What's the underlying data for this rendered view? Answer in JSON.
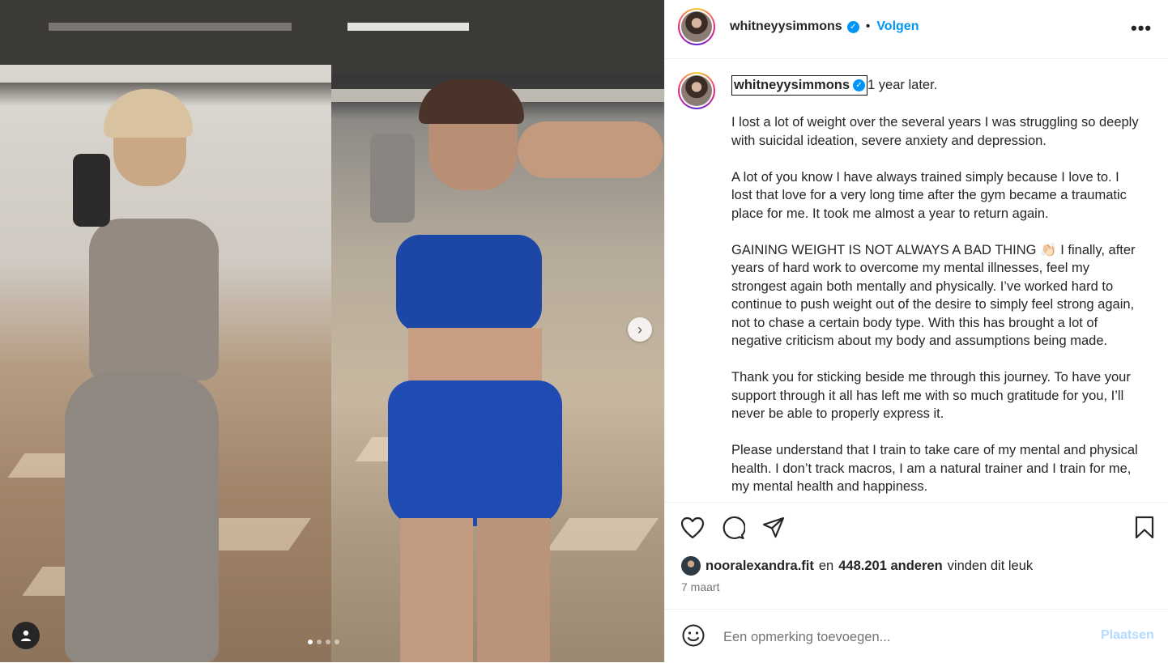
{
  "media": {
    "carousel_dot_count": 4,
    "active_dot_index": 0
  },
  "header": {
    "username": "whitneyysimmons",
    "separator": "•",
    "follow_label": "Volgen",
    "more_icon": "more-horizontal-icon",
    "verified_icon": "verified-badge-icon"
  },
  "caption": {
    "username": "whitneyysimmons",
    "first_line": "1 year later.",
    "paragraphs": [
      "I lost a lot of weight over the several years I was struggling so deeply with suicidal ideation, severe anxiety and depression.",
      "A lot of you know I have always trained simply because I love to. I lost that love for a very long time after the gym became a traumatic place for me. It took me almost a year to return again.",
      "GAINING WEIGHT IS NOT ALWAYS A BAD THING 👏🏻 I finally, after years of hard work to overcome my mental illnesses, feel my strongest again both mentally and physically. I’ve worked hard to continue to push weight out of the desire to simply feel strong again, not to chase a certain body type. With this has brought a lot of negative criticism about my body and assumptions being made.",
      "Thank you for sticking beside me through this journey. To have your support through it all has left me with so much gratitude for you, I’ll never be able to properly express it.",
      "Please understand that I train to take care of my mental and physical health. I don’t track macros, I am a natural trainer and I train for me, my mental health and happiness."
    ]
  },
  "actions": {
    "like_icon": "heart-icon",
    "comment_icon": "comment-icon",
    "share_icon": "share-icon",
    "save_icon": "bookmark-icon"
  },
  "likes": {
    "liked_by": "nooralexandra.fit",
    "connector": "en",
    "count": "448.201 anderen",
    "suffix": "vinden dit leuk"
  },
  "date": "7 maart",
  "comment": {
    "placeholder": "Een opmerking toevoegen...",
    "post_label": "Plaatsen",
    "emoji_icon": "emoji-smiley-icon"
  },
  "colors": {
    "accent_blue": "#0095f6",
    "post_disabled": "#b3dbff",
    "text_primary": "#262626",
    "text_secondary": "#737373"
  }
}
